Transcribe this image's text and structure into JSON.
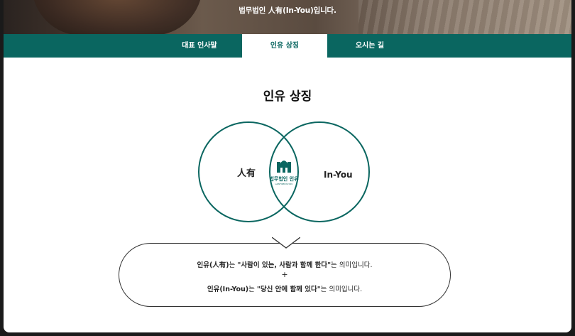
{
  "hero": {
    "text": "법무법인 人有(In-You)입니다."
  },
  "tabs": [
    {
      "label": "대표 인사말",
      "active": false
    },
    {
      "label": "인유 상징",
      "active": true
    },
    {
      "label": "오시는 길",
      "active": false
    }
  ],
  "section": {
    "title": "인유 상징"
  },
  "venn": {
    "left_label": "人有",
    "right_label": "In-You",
    "logo_text": "법무법인 인유",
    "logo_subtext": "LAWFIRM IN-YOU",
    "circle_color": "#0a6660"
  },
  "meaning": {
    "line1_prefix": "인유(人有)",
    "line1_mid": "는 ",
    "line1_quote": "\"사람이 있는, 사람과 함께 한다\"",
    "line1_suffix": "는 의미입니다.",
    "plus": "+",
    "line2_prefix": "인유(In-You)",
    "line2_mid": "는 ",
    "line2_quote": "\"당신 안에 함께 있다\"",
    "line2_suffix": "는 의미입니다."
  },
  "colors": {
    "brand": "#0a6660",
    "background": "#ffffff"
  }
}
